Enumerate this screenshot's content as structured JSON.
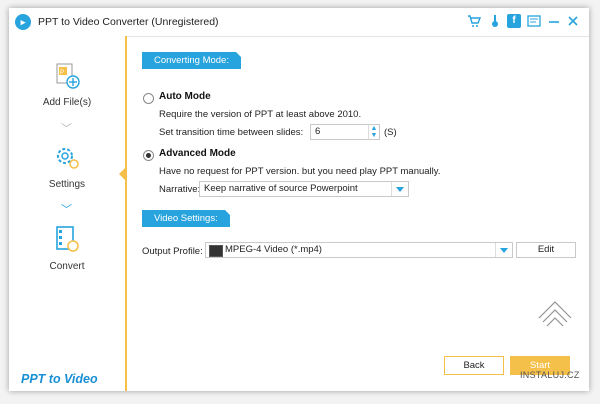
{
  "window": {
    "title": "PPT to Video Converter (Unregistered)",
    "title_icons": [
      "cart-icon",
      "key-icon",
      "facebook-icon",
      "feedback-icon",
      "minimize-icon",
      "close-icon"
    ]
  },
  "sidebar": {
    "items": [
      {
        "label": "Add File(s)",
        "icon": "add-file-icon"
      },
      {
        "label": "Settings",
        "icon": "settings-icon"
      },
      {
        "label": "Convert",
        "icon": "convert-icon"
      }
    ],
    "brand": "PPT to Video"
  },
  "converting": {
    "header": "Converting Mode:",
    "auto": {
      "label": "Auto Mode",
      "desc": "Require the version of PPT at least above 2010.",
      "transition_label": "Set transition time between slides:",
      "transition_value": "6",
      "unit": "(S)",
      "selected": false
    },
    "advanced": {
      "label": "Advanced Mode",
      "desc": "Have no request for PPT version. but you need play PPT manually.",
      "narrative_label": "Narrative:",
      "narrative_value": "Keep narrative of source Powerpoint",
      "selected": true
    }
  },
  "video": {
    "header": "Video Settings:",
    "profile_label": "Output Profile:",
    "profile_value": "MPEG-4 Video (*.mp4)",
    "edit_label": "Edit"
  },
  "footer": {
    "back_label": "Back",
    "start_label": "Start"
  },
  "watermark": "INSTALUJ.CZ",
  "colors": {
    "accent": "#27a3dd",
    "highlight": "#f5c04a"
  }
}
